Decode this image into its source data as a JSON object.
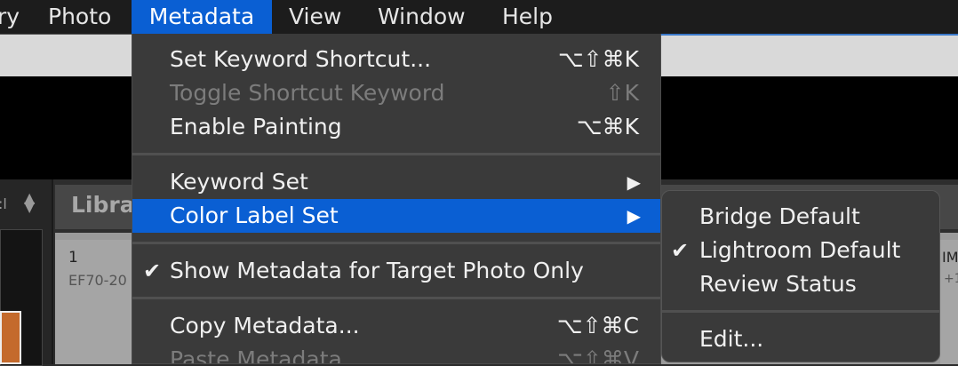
{
  "menubar": {
    "items": [
      "ry",
      "Photo",
      "Metadata",
      "View",
      "Window",
      "Help"
    ],
    "active": "Metadata"
  },
  "background": {
    "left_label": ":l",
    "library_title": "Libra",
    "cell_number": "1",
    "cell_subtitle": "EF70-20",
    "right_cell_text": "IM",
    "right_cell_sub": "+1"
  },
  "menu": {
    "items": [
      {
        "label": "Set Keyword Shortcut...",
        "shortcut": "⌥⇧⌘K"
      },
      {
        "label": "Toggle Shortcut Keyword",
        "shortcut": "⇧K",
        "disabled": true
      },
      {
        "label": "Enable Painting",
        "shortcut": "⌥⌘K"
      },
      {
        "label": "Keyword Set",
        "submenu_arrow": "▶"
      },
      {
        "label": "Color Label Set",
        "submenu_arrow": "▶",
        "highlighted": true
      },
      {
        "label": "Show Metadata for Target Photo Only",
        "check": "✔"
      },
      {
        "label": "Copy Metadata...",
        "shortcut": "⌥⇧⌘C"
      },
      {
        "label": "Paste Metadata",
        "shortcut": "⌥⇧⌘V",
        "disabled": true
      }
    ]
  },
  "submenu": {
    "items": [
      {
        "label": "Bridge Default"
      },
      {
        "label": "Lightroom Default",
        "check": "✔"
      },
      {
        "label": "Review Status"
      },
      {
        "label": "Edit..."
      }
    ]
  },
  "colors": {
    "highlight": "#0a5fd3",
    "menu_bg": "#3a3a3a",
    "menubar_bg": "#1c1c1c"
  }
}
